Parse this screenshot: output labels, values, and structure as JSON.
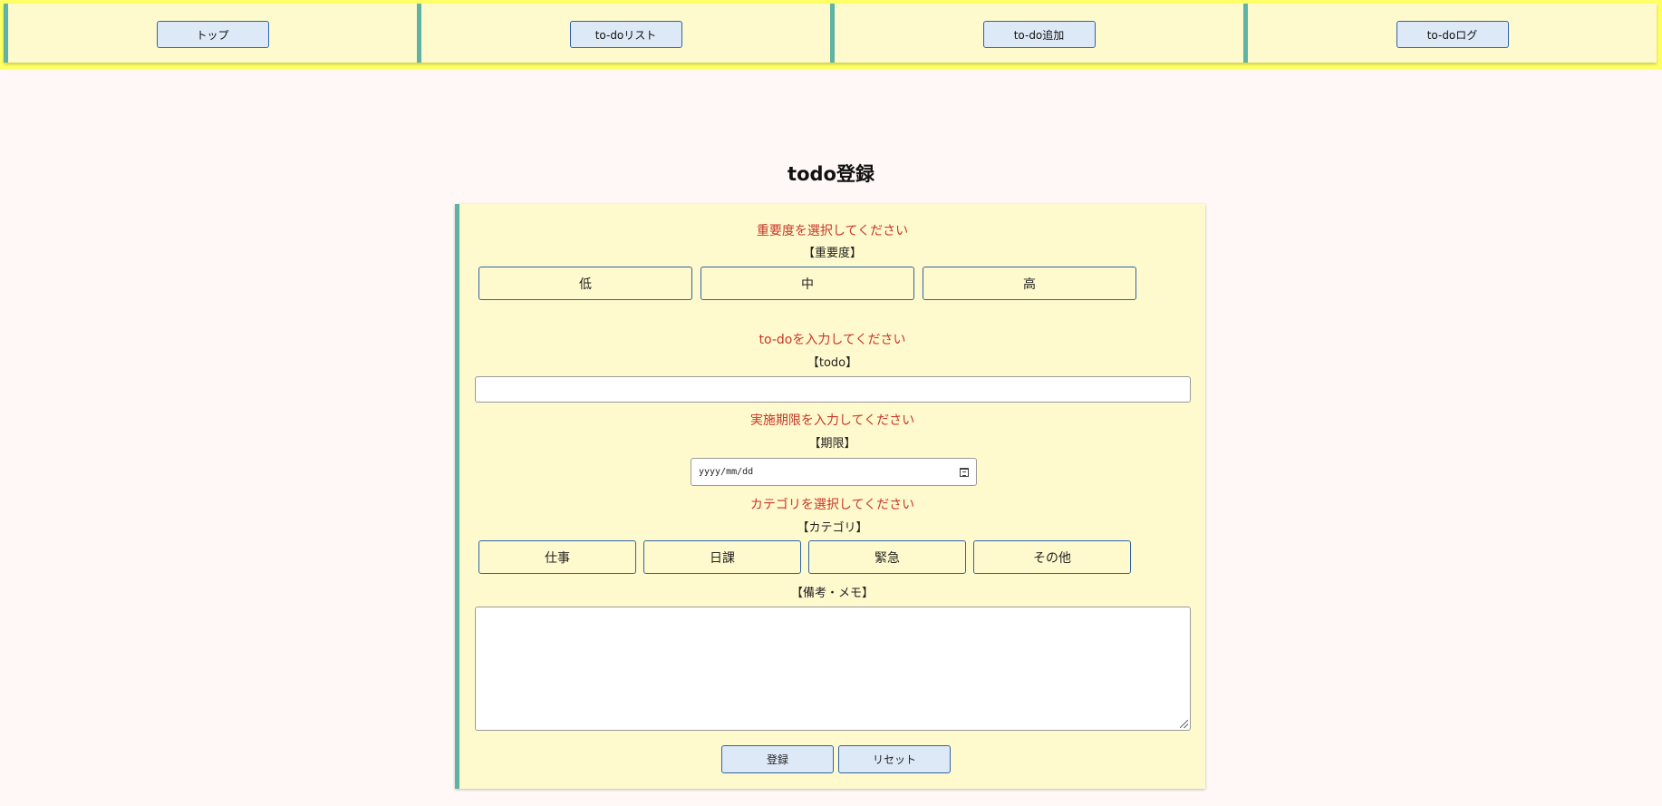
{
  "nav": {
    "items": [
      {
        "label": "トップ"
      },
      {
        "label": "to-doリスト"
      },
      {
        "label": "to-do追加"
      },
      {
        "label": "to-doログ"
      }
    ]
  },
  "page": {
    "title": "todo登録"
  },
  "form": {
    "priority": {
      "warning": "重要度を選択してください",
      "label": "【重要度】",
      "options": [
        "低",
        "中",
        "高"
      ]
    },
    "todo": {
      "warning": "to-doを入力してください",
      "label": "【todo】",
      "value": ""
    },
    "deadline": {
      "warning": "実施期限を入力してください",
      "label": "【期限】",
      "placeholder": "yyyy/mm/dd"
    },
    "category": {
      "warning": "カテゴリを選択してください",
      "label": "【カテゴリ】",
      "options": [
        "仕事",
        "日課",
        "緊急",
        "その他"
      ]
    },
    "memo": {
      "label": "【備考・メモ】",
      "value": ""
    },
    "submit_label": "登録",
    "reset_label": "リセット"
  },
  "colors": {
    "nav_background": "#ffff66",
    "panel_background": "#fffacd",
    "accent_border": "#5fb3a4",
    "button_fill": "#dde9f7",
    "button_border": "#2d64a8",
    "warning_text": "#c8362b",
    "page_background": "#fff8f6"
  }
}
